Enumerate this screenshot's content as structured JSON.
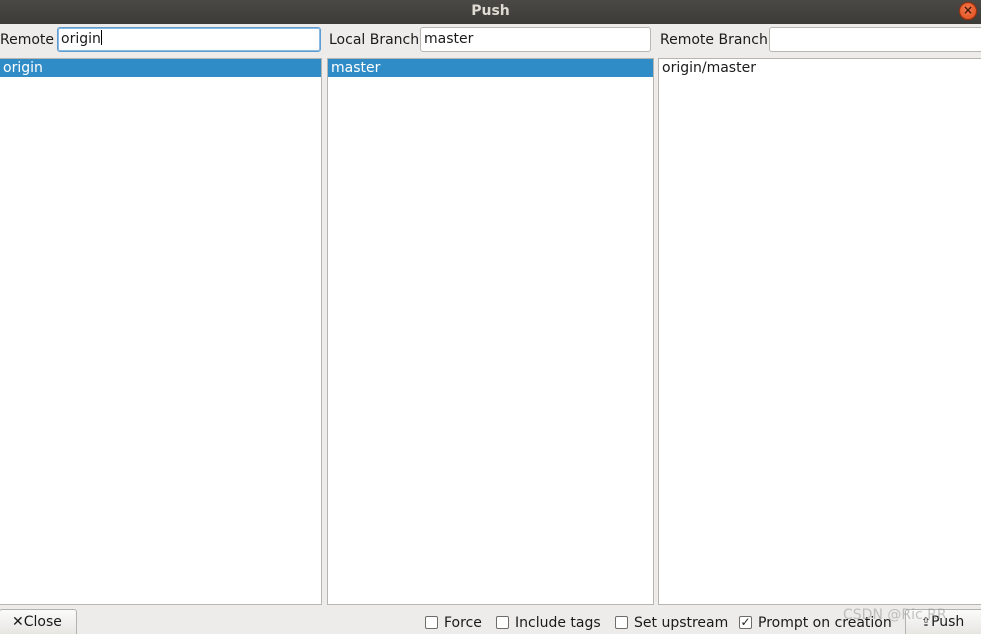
{
  "window": {
    "title": "Push"
  },
  "remote": {
    "label": "Remote",
    "value": "origin",
    "items": [
      "origin"
    ],
    "selected_index": 0
  },
  "local_branch": {
    "label": "Local Branch",
    "value": "master",
    "items": [
      "master"
    ],
    "selected_index": 0
  },
  "remote_branch": {
    "label": "Remote Branch",
    "value": "",
    "items": [
      "origin/master"
    ]
  },
  "footer": {
    "close_label": "Close",
    "close_icon": "x-icon",
    "options": [
      {
        "label": "Force",
        "checked": false
      },
      {
        "label": "Include tags",
        "checked": false
      },
      {
        "label": "Set upstream",
        "checked": false
      },
      {
        "label": "Prompt on creation",
        "checked": true
      }
    ],
    "push_label": "Push",
    "push_icon": "push-icon",
    "watermark": "CSDN @Ric.RR"
  },
  "colors": {
    "selection": "#308cc6",
    "titlebar": "#3c3b37",
    "close_button": "#df4b16",
    "window_bg": "#edeceb"
  }
}
